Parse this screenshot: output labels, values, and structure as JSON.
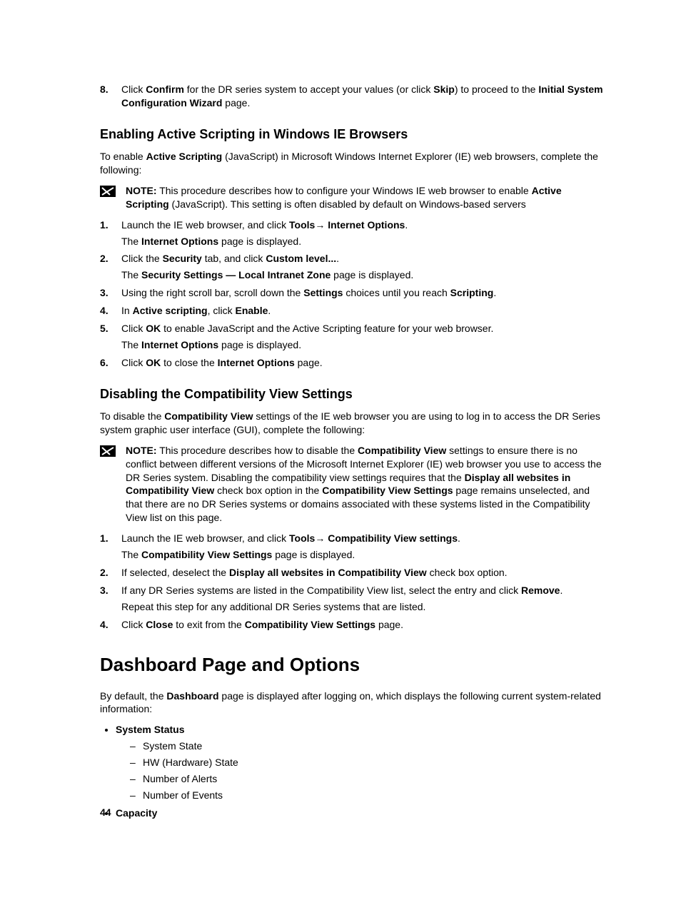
{
  "step8": {
    "pre": "Click ",
    "b1": "Confirm",
    "mid1": " for the DR series system to accept your values (or click ",
    "b2": "Skip",
    "mid2": ") to proceed to the ",
    "b3": "Initial System Configuration Wizard",
    "post": " page."
  },
  "sec1": {
    "heading": "Enabling Active Scripting in Windows IE Browsers",
    "intro_pre": "To enable ",
    "intro_b": "Active Scripting",
    "intro_post": " (JavaScript) in Microsoft Windows Internet Explorer (IE) web browsers, complete the following:",
    "note_label": "NOTE:",
    "note_pre": " This procedure describes how to configure your Windows IE web browser to enable ",
    "note_b": "Active Scripting",
    "note_post": " (JavaScript). This setting is often disabled by default on Windows-based servers",
    "s1": {
      "pre": "Launch the IE web browser, and click ",
      "b1": "Tools",
      "arr": "→ ",
      "b2": "Internet Options",
      "post": ".",
      "sub_pre": "The ",
      "sub_b": "Internet Options",
      "sub_post": " page is displayed."
    },
    "s2": {
      "pre": "Click the ",
      "b1": "Security",
      "mid": " tab, and click ",
      "b2": "Custom level...",
      "post": ".",
      "sub_pre": "The ",
      "sub_b": "Security Settings — Local Intranet Zone",
      "sub_post": " page is displayed."
    },
    "s3": {
      "pre": "Using the right scroll bar, scroll down the ",
      "b1": "Settings",
      "mid": " choices until you reach ",
      "b2": "Scripting",
      "post": "."
    },
    "s4": {
      "pre": "In ",
      "b1": "Active scripting",
      "mid": ", click ",
      "b2": "Enable",
      "post": "."
    },
    "s5": {
      "pre": "Click ",
      "b1": "OK",
      "post": " to enable JavaScript and the Active Scripting feature for your web browser.",
      "sub_pre": "The ",
      "sub_b": "Internet Options",
      "sub_post": " page is displayed."
    },
    "s6": {
      "pre": "Click ",
      "b1": "OK",
      "mid": " to close the ",
      "b2": "Internet Options",
      "post": " page."
    }
  },
  "sec2": {
    "heading": "Disabling the Compatibility View Settings",
    "intro_pre": "To disable the ",
    "intro_b": "Compatibility View",
    "intro_post": " settings of the IE web browser you are using to log in to access the DR Series system graphic user interface (GUI), complete the following:",
    "note_label": "NOTE:",
    "note_pre": " This procedure describes how to disable the ",
    "note_b1": "Compatibility View",
    "note_mid1": " settings to ensure there is no conflict between different versions of the Microsoft Internet Explorer (IE) web browser you use to access the DR Series system. Disabling the compatibility view settings requires that the ",
    "note_b2": "Display all websites in Compatibility View",
    "note_mid2": " check box option in the ",
    "note_b3": "Compatibility View Settings",
    "note_post": " page remains unselected, and that there are no DR Series systems or domains associated with these systems listed in the Compatibility View list on this page.",
    "s1": {
      "pre": "Launch the IE web browser, and click ",
      "b1": "Tools",
      "arr": "→ ",
      "b2": "Compatibility View settings",
      "post": ".",
      "sub_pre": "The ",
      "sub_b": "Compatibility View Settings",
      "sub_post": " page is displayed."
    },
    "s2": {
      "pre": "If selected, deselect the ",
      "b1": "Display all websites in Compatibility View",
      "post": " check box option."
    },
    "s3": {
      "pre": "If any DR Series systems are listed in the Compatibility View list, select the entry and click ",
      "b1": "Remove",
      "post": ".",
      "sub": "Repeat this step for any additional DR Series systems that are listed."
    },
    "s4": {
      "pre": "Click ",
      "b1": "Close",
      "mid": " to exit from the ",
      "b2": "Compatibility View Settings",
      "post": " page."
    }
  },
  "sec3": {
    "heading": "Dashboard Page and Options",
    "intro_pre": "By default, the ",
    "intro_b": "Dashboard",
    "intro_post": " page is displayed after logging on, which displays the following current system-related information:",
    "b1": "System Status",
    "sub_items": [
      "System State",
      "HW (Hardware) State",
      "Number of Alerts",
      "Number of Events"
    ],
    "b2": "Capacity"
  },
  "page_number": "44"
}
